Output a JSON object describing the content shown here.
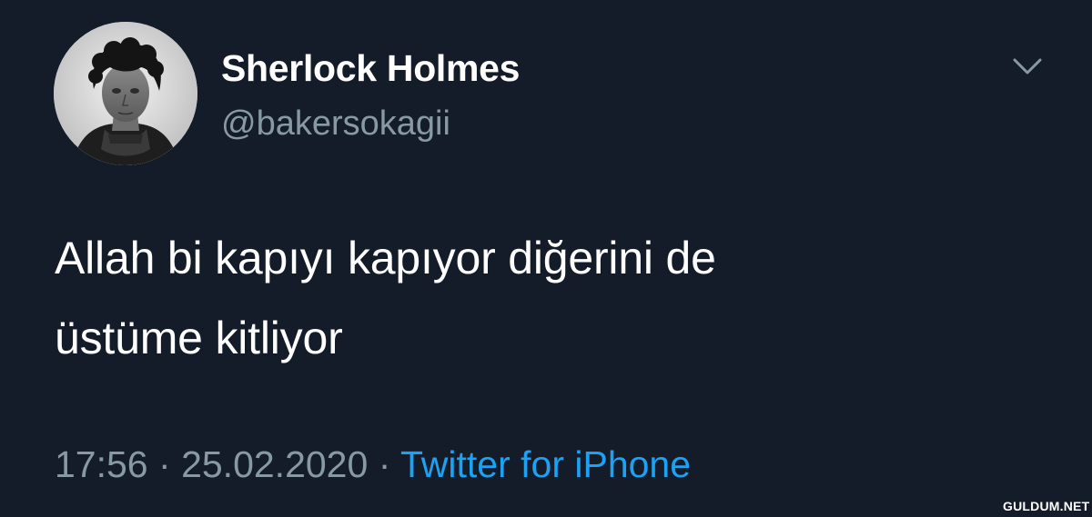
{
  "tweet": {
    "author": {
      "display_name": "Sherlock Holmes",
      "handle": "@bakersokagii",
      "avatar_icon": "sherlock-portrait-avatar"
    },
    "menu_icon": "chevron-down-icon",
    "text_lines": [
      "Allah bi kapıyı kapıyor diğerini de",
      "üstüme kitliyor"
    ],
    "meta": {
      "time": "17:56",
      "separator": "·",
      "date": "25.02.2020",
      "source": "Twitter for iPhone"
    }
  },
  "watermark": "GULDUM.NET",
  "colors": {
    "background": "#151c29",
    "primary_text": "#ffffff",
    "secondary_text": "#8899a6",
    "link": "#1da1f2"
  }
}
